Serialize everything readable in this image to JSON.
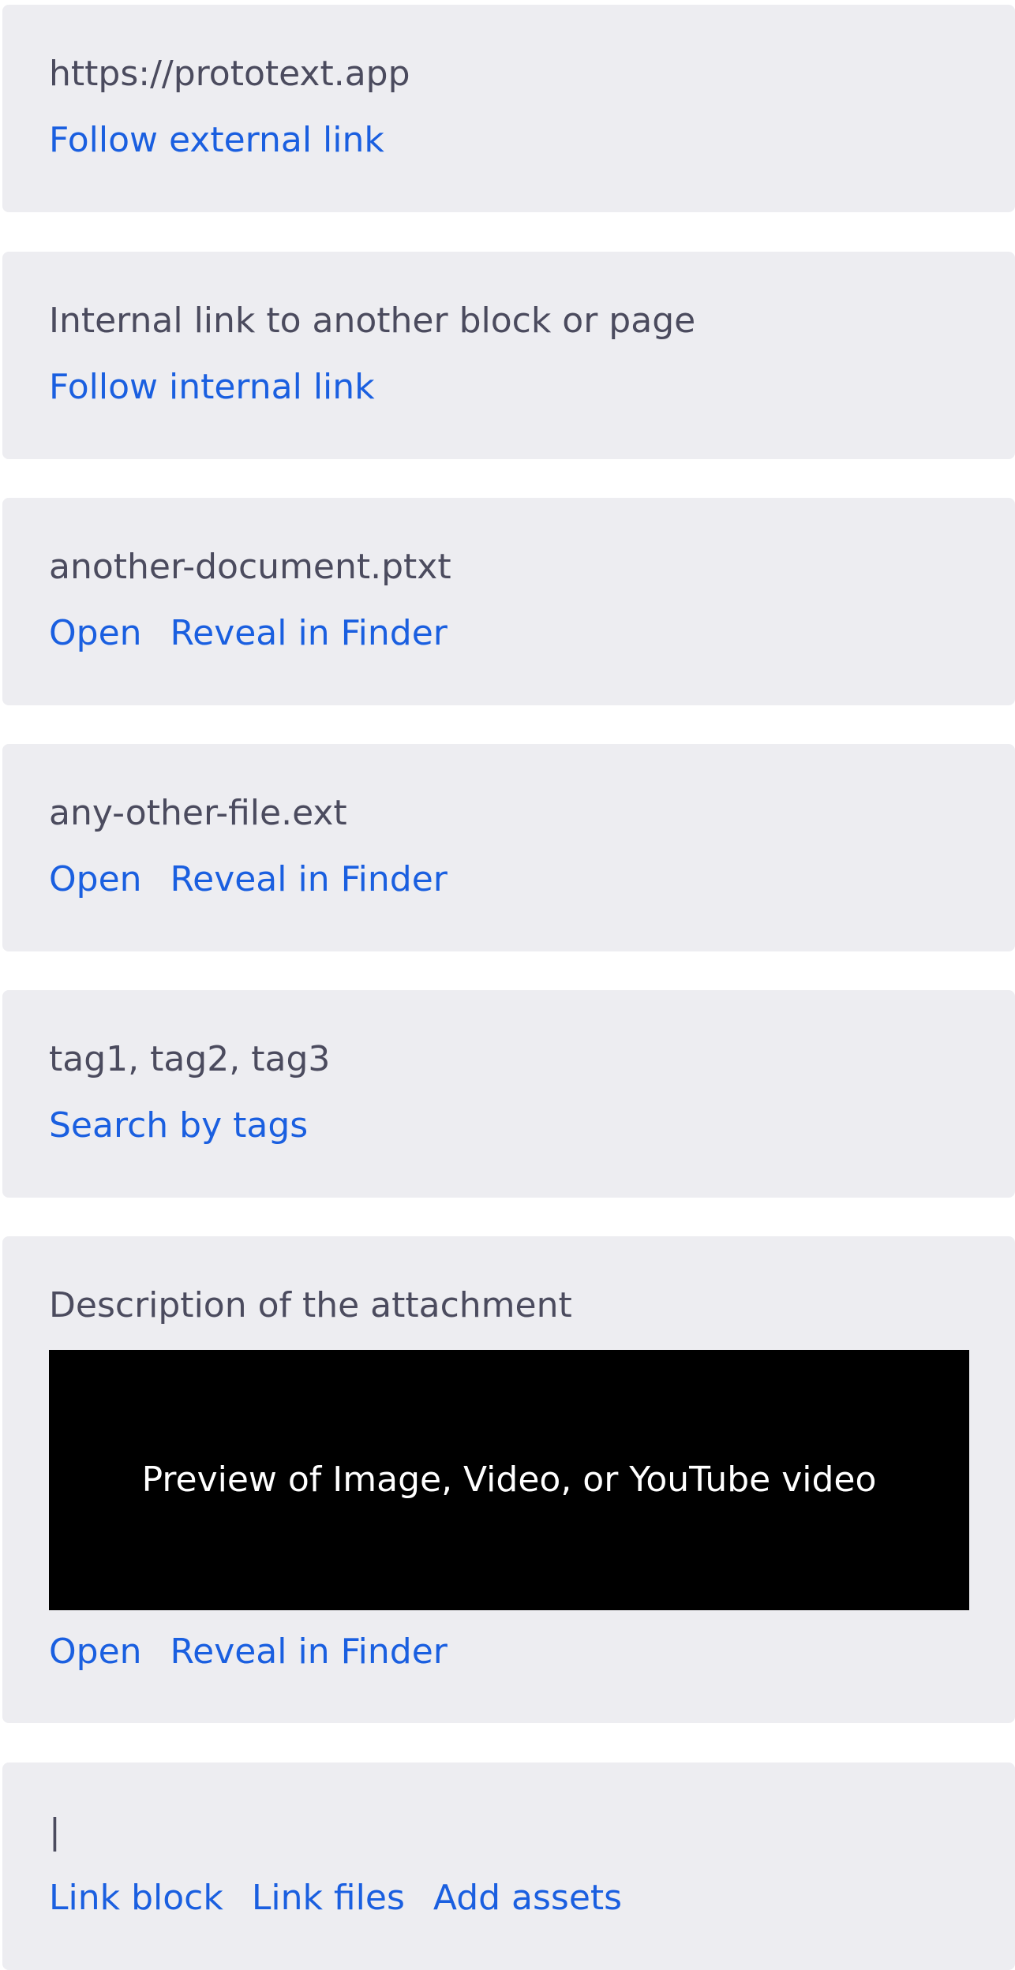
{
  "blocks": [
    {
      "label": "https://prototext.app",
      "actions": [
        "Follow external link"
      ]
    },
    {
      "label": "Internal link to another block or page",
      "actions": [
        "Follow internal link"
      ]
    },
    {
      "label": "another-document.ptxt",
      "actions": [
        "Open",
        "Reveal in Finder"
      ]
    },
    {
      "label": "any-other-file.ext",
      "actions": [
        "Open",
        "Reveal in Finder"
      ]
    },
    {
      "label": "tag1, tag2, tag3",
      "actions": [
        "Search by tags"
      ]
    },
    {
      "label": "Description of the attachment",
      "preview_text": "Preview of Image, Video, or YouTube video",
      "actions": [
        "Open",
        "Reveal in Finder"
      ]
    },
    {
      "label": "|",
      "actions": [
        "Link block",
        "Link files",
        "Add assets"
      ]
    }
  ],
  "colors": {
    "card_background": "#ededf1",
    "label_text": "#4b4b5e",
    "link": "#1a5fe0",
    "preview_background": "#000000",
    "preview_text": "#ffffff"
  }
}
